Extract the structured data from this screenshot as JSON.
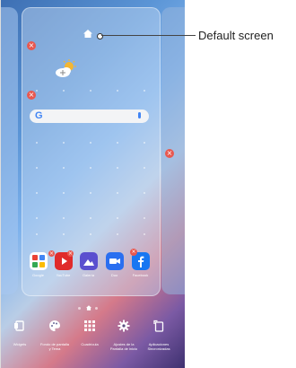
{
  "callout": {
    "text": "Default screen"
  },
  "colors": {
    "remove_badge": "#e8584f",
    "search_accent": "#4285f4"
  },
  "home": {
    "icon": "home-icon"
  },
  "search_bar": {
    "logo": "G",
    "icon": "mic-icon"
  },
  "apps": [
    {
      "label": "Google",
      "icon": "google-folder-icon",
      "color": "#d33a3a"
    },
    {
      "label": "YouTube",
      "icon": "youtube-icon",
      "color": "#e02b2b"
    },
    {
      "label": "Galería",
      "icon": "gallery-icon",
      "color": "#5a4fcf"
    },
    {
      "label": "Duo",
      "icon": "duo-icon",
      "color": "#2a6ff0"
    },
    {
      "label": "Facebook",
      "icon": "facebook-icon",
      "color": "#1877f2"
    }
  ],
  "toolbar": [
    {
      "label": "Widgets",
      "icon": "widgets-icon"
    },
    {
      "label": "Fondo de pantalla y Tema",
      "icon": "palette-icon"
    },
    {
      "label": "Cuadrícula",
      "icon": "grid-icon"
    },
    {
      "label": "Ajustes de la Pantalla de inicio",
      "icon": "gear-icon"
    },
    {
      "label": "Aplicaciones Sincronizadas",
      "icon": "sync-apps-icon"
    }
  ]
}
